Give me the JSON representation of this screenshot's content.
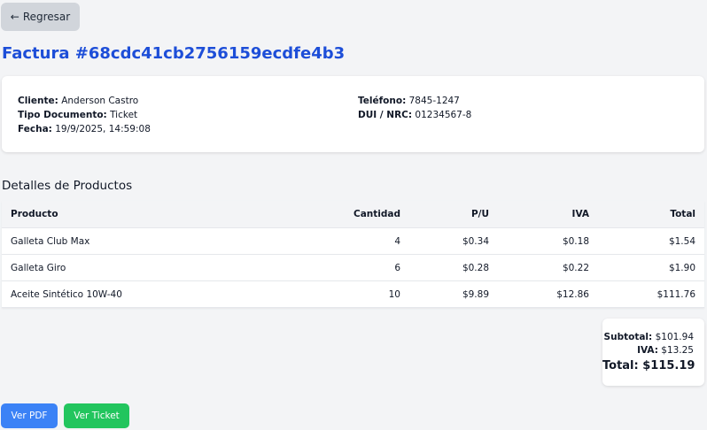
{
  "nav": {
    "back_icon": "←",
    "back_label": "Regresar"
  },
  "invoice": {
    "title": "Factura #68cdc41cb2756159ecdfe4b3"
  },
  "customer": {
    "cliente_label": "Cliente:",
    "cliente_value": "Anderson Castro",
    "tipo_label": "Tipo Documento:",
    "tipo_value": "Ticket",
    "fecha_label": "Fecha:",
    "fecha_value": "19/9/2025, 14:59:08",
    "telefono_label": "Teléfono:",
    "telefono_value": "7845-1247",
    "dui_label": "DUI / NRC:",
    "dui_value": "01234567-8"
  },
  "products": {
    "section_title": "Detalles de Productos",
    "columns": {
      "producto": "Producto",
      "cantidad": "Cantidad",
      "pu": "P/U",
      "iva": "IVA",
      "total": "Total"
    },
    "rows": [
      {
        "producto": "Galleta Club Max",
        "cantidad": "4",
        "pu": "$0.34",
        "iva": "$0.18",
        "total": "$1.54"
      },
      {
        "producto": "Galleta Giro",
        "cantidad": "6",
        "pu": "$0.28",
        "iva": "$0.22",
        "total": "$1.90"
      },
      {
        "producto": "Aceite Sintético 10W-40",
        "cantidad": "10",
        "pu": "$9.89",
        "iva": "$12.86",
        "total": "$111.76"
      }
    ]
  },
  "totals": {
    "subtotal_label": "Subtotal:",
    "subtotal_value": "$101.94",
    "iva_label": "IVA:",
    "iva_value": "$13.25",
    "total_label": "Total:",
    "total_value": "$115.19"
  },
  "actions": {
    "pdf_label": "Ver PDF",
    "ticket_label": "Ver Ticket"
  },
  "colors": {
    "title_blue": "#1d4ed8",
    "pdf_button": "#3b82f6",
    "ticket_button": "#22c55e",
    "back_button": "#d1d5db"
  }
}
